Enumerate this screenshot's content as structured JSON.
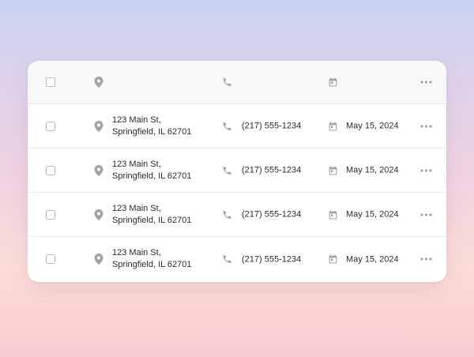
{
  "table": {
    "header": {
      "icons": [
        "location-pin-icon",
        "phone-icon",
        "calendar-icon",
        "more-horizontal-icon"
      ]
    },
    "rows": [
      {
        "address_line1": "123 Main St,",
        "address_line2": "Springfield, IL 62701",
        "phone": "(217) 555-1234",
        "date": "May 15, 2024"
      },
      {
        "address_line1": "123 Main St,",
        "address_line2": "Springfield, IL 62701",
        "phone": "(217) 555-1234",
        "date": "May 15, 2024"
      },
      {
        "address_line1": "123 Main St,",
        "address_line2": "Springfield, IL 62701",
        "phone": "(217) 555-1234",
        "date": "May 15, 2024"
      },
      {
        "address_line1": "123 Main St,",
        "address_line2": "Springfield, IL 62701",
        "phone": "(217) 555-1234",
        "date": "May 15, 2024"
      }
    ]
  },
  "colors": {
    "icon": "#a3a3a3",
    "text": "#2b2b2b",
    "header_bg": "#f8f8f8",
    "divider": "#ececec"
  }
}
